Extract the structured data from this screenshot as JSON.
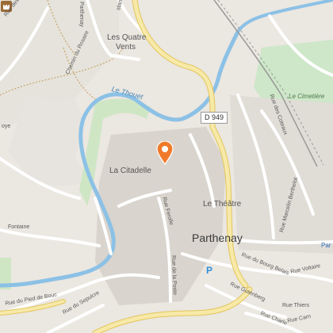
{
  "map": {
    "colors": {
      "background": "#ebe7e1",
      "field": "#e5e3dc",
      "road_major": "#f7e9a8",
      "road_major_edge": "#e2c65d",
      "road_minor": "#ffffff",
      "water": "#8cc1e6",
      "park": "#cfe6c4",
      "cemetery": "#cde7c8",
      "trail": "#c9a66b",
      "railway": "#9a9a9a",
      "marker": "#f07a2a"
    },
    "marker": {
      "icon": "map-pin-icon"
    },
    "labels": {
      "rue_des_ponts": "Rue des Ponts",
      "parthenay_road": "Parthenay",
      "stant": "stant",
      "quatre_vents_1": "Les Quatre",
      "quatre_vents_2": "Vents",
      "chemin_rosaire": "Chemin du Rosaire",
      "thouet": "Le Thouet",
      "d949": "D 949",
      "cimetiere": "Le Cimetière",
      "coteaux": "Rue des Coteaux",
      "marcelin": "Rue Marcelin Berthelot",
      "citadelle": "La Citadelle",
      "ferolle": "Rue Ferolle",
      "theatre": "Le Théâtre",
      "parthenay_city": "Parthenay",
      "fontaine": "Fontaine",
      "bourg_belais": "Rue du Bourg Belais",
      "voltaire": "Rue Voltaire",
      "par_edge": "Par",
      "la_poste": "Rue de la Poste",
      "pied_de_bouc": "Rue du Pied de Bouc",
      "sepulcre": "Rue du Sepulcre",
      "gutenberg": "Rue Gutenberg",
      "thiers": "Rue Thiers",
      "charles": "Rue Charle",
      "carnot": "Rue Carn",
      "oye": "oye",
      "parking": "P"
    }
  }
}
